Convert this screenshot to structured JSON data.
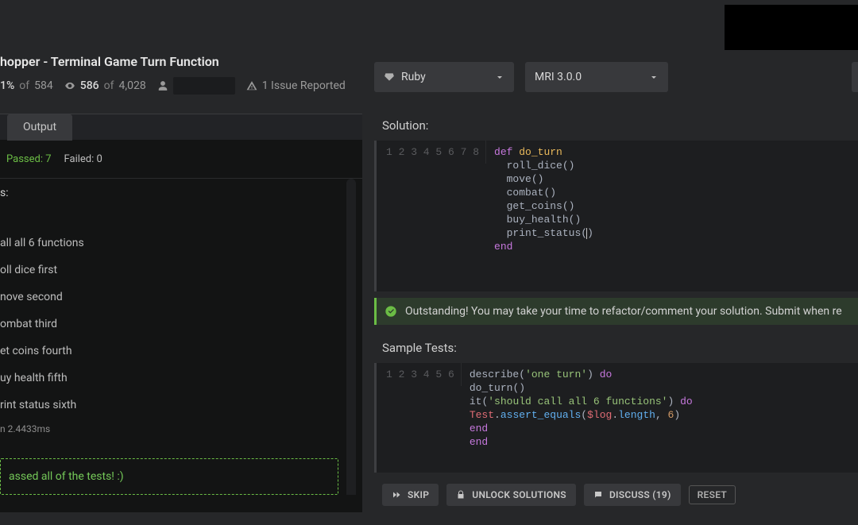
{
  "kata": {
    "title": "hopper - Terminal Game Turn Function",
    "progress": {
      "pct": "1%",
      "of_word": "of",
      "total": "584"
    },
    "honor": {
      "value": "586",
      "of_word": "of",
      "total": "4,028"
    },
    "issue": "1 Issue Reported"
  },
  "selectors": {
    "language": "Ruby",
    "version": "MRI 3.0.0"
  },
  "output": {
    "tab_label": "Output",
    "passed_label": "Passed: 7",
    "failed_label": "Failed: 0",
    "heading": "s:",
    "checks": [
      "all all 6 functions",
      "oll dice first",
      "nove second",
      "ombat third",
      "et coins fourth",
      "uy health fifth",
      "rint status sixth"
    ],
    "time": "n 2.4433ms",
    "pass_msg": "assed all of the tests! :)"
  },
  "solution": {
    "label": "Solution:",
    "lines": [
      [
        [
          "kw",
          "def "
        ],
        [
          "def",
          "do_turn"
        ]
      ],
      [
        [
          "punc",
          "  roll_dice"
        ],
        [
          "punc",
          "()"
        ]
      ],
      [
        [
          "punc",
          "  move"
        ],
        [
          "punc",
          "()"
        ]
      ],
      [
        [
          "punc",
          "  combat"
        ],
        [
          "punc",
          "()"
        ]
      ],
      [
        [
          "punc",
          "  get_coins"
        ],
        [
          "punc",
          "()"
        ]
      ],
      [
        [
          "punc",
          "  buy_health"
        ],
        [
          "punc",
          "()"
        ]
      ],
      [
        [
          "punc",
          "  print_status("
        ],
        [
          "caret",
          ""
        ],
        [
          "punc",
          ")"
        ]
      ],
      [
        [
          "kw",
          "end"
        ]
      ]
    ]
  },
  "ok_msg": "Outstanding! You may take your time to refactor/comment your solution. Submit when re",
  "tests": {
    "label": "Sample Tests:",
    "lines": [
      [
        [
          "punc",
          "describe"
        ],
        [
          "punc",
          "("
        ],
        [
          "str",
          "'one turn'"
        ],
        [
          "punc",
          ") "
        ],
        [
          "kw",
          "do"
        ]
      ],
      [
        [
          "punc",
          "do_turn"
        ],
        [
          "punc",
          "()"
        ]
      ],
      [
        [
          "punc",
          "it"
        ],
        [
          "punc",
          "("
        ],
        [
          "str",
          "'should call all 6 functions'"
        ],
        [
          "punc",
          ") "
        ],
        [
          "kw",
          "do"
        ]
      ],
      [
        [
          "const",
          "Test"
        ],
        [
          "punc",
          "."
        ],
        [
          "method",
          "assert_equals"
        ],
        [
          "punc",
          "("
        ],
        [
          "var",
          "$log"
        ],
        [
          "punc",
          "."
        ],
        [
          "method",
          "length"
        ],
        [
          "punc",
          ", "
        ],
        [
          "num",
          "6"
        ],
        [
          "punc",
          ")"
        ]
      ],
      [
        [
          "kw",
          "end"
        ]
      ],
      [
        [
          "kw",
          "end"
        ]
      ]
    ]
  },
  "actions": {
    "skip": "SKIP",
    "unlock": "UNLOCK SOLUTIONS",
    "discuss": "DISCUSS (19)",
    "reset": "RESET"
  }
}
